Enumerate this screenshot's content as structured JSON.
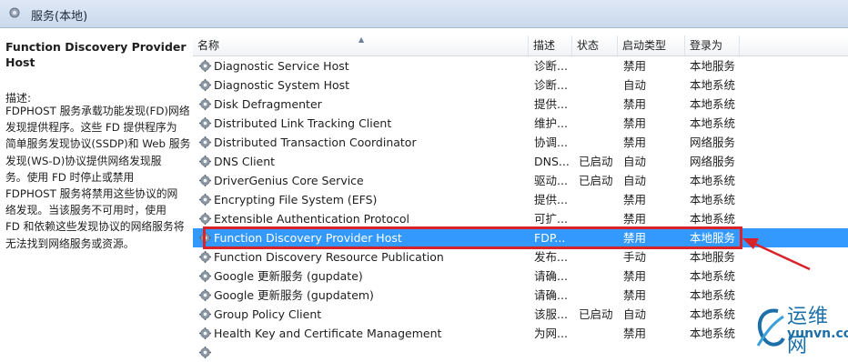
{
  "window": {
    "title": "服务(本地)"
  },
  "left_pane": {
    "service_title": "Function Discovery Provider Host",
    "description_label": "描述:",
    "description_lines": [
      "FDPHOST 服务承载功能发现(FD)网络",
      "发现提供程序。这些 FD 提供程序为",
      "简单服务发现协议(SSDP)和 Web 服务",
      "发现(WS-D)协议提供网络发现服",
      "务。使用 FD 时停止或禁用",
      "FDPHOST 服务将禁用这些协议的网",
      "络发现。当该服务不可用时，使用",
      "FD 和依赖这些发现协议的网络服务将",
      "无法找到网络服务或资源。"
    ]
  },
  "columns": {
    "name": "名称",
    "description": "描述",
    "status": "状态",
    "startup": "启动类型",
    "logon": "登录为"
  },
  "services": [
    {
      "name": "Diagnostic Service Host",
      "description": "诊断...",
      "status": "",
      "startup": "禁用",
      "logon": "本地服务"
    },
    {
      "name": "Diagnostic System Host",
      "description": "诊断...",
      "status": "",
      "startup": "自动",
      "logon": "本地系统"
    },
    {
      "name": "Disk Defragmenter",
      "description": "提供...",
      "status": "",
      "startup": "禁用",
      "logon": "本地系统"
    },
    {
      "name": "Distributed Link Tracking Client",
      "description": "维护...",
      "status": "",
      "startup": "禁用",
      "logon": "本地系统"
    },
    {
      "name": "Distributed Transaction Coordinator",
      "description": "协调...",
      "status": "",
      "startup": "禁用",
      "logon": "网络服务"
    },
    {
      "name": "DNS Client",
      "description": "DNS...",
      "status": "已启动",
      "startup": "自动",
      "logon": "网络服务"
    },
    {
      "name": "DriverGenius Core Service",
      "description": "驱动...",
      "status": "已启动",
      "startup": "自动",
      "logon": "本地系统"
    },
    {
      "name": "Encrypting File System (EFS)",
      "description": "提供...",
      "status": "",
      "startup": "禁用",
      "logon": "本地系统"
    },
    {
      "name": "Extensible Authentication Protocol",
      "description": "可扩...",
      "status": "",
      "startup": "禁用",
      "logon": "本地系统"
    },
    {
      "name": "Function Discovery Provider Host",
      "description": "FDP...",
      "status": "",
      "startup": "禁用",
      "logon": "本地服务",
      "selected": true
    },
    {
      "name": "Function Discovery Resource Publication",
      "description": "发布...",
      "status": "",
      "startup": "手动",
      "logon": "本地服务"
    },
    {
      "name": "Google 更新服务 (gupdate)",
      "description": "请确...",
      "status": "",
      "startup": "禁用",
      "logon": "本地系统"
    },
    {
      "name": "Google 更新服务 (gupdatem)",
      "description": "请确...",
      "status": "",
      "startup": "禁用",
      "logon": "本地系统"
    },
    {
      "name": "Group Policy Client",
      "description": "该服...",
      "status": "已启动",
      "startup": "自动",
      "logon": "本地系统"
    },
    {
      "name": "Health Key and Certificate Management",
      "description": "为网...",
      "status": "",
      "startup": "禁用",
      "logon": "本地系统"
    },
    {
      "name": "",
      "description": "",
      "status": "",
      "startup": "",
      "logon": ""
    }
  ],
  "watermark": {
    "text_cn": "运维网",
    "text_en": "yunvn.com"
  },
  "colors": {
    "selection": "#3399ff",
    "highlight_box": "#d9232a",
    "watermark": "#1c6fa8"
  }
}
